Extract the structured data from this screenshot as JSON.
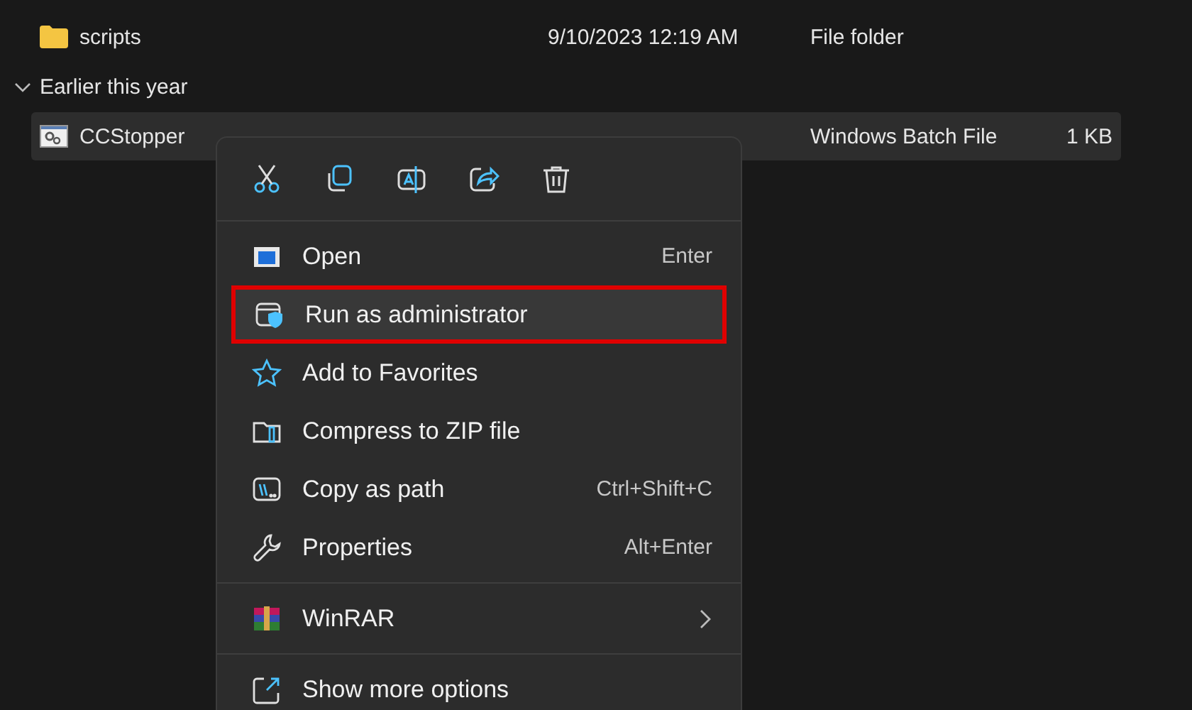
{
  "files": [
    {
      "name": "scripts",
      "date": "9/10/2023 12:19 AM",
      "type": "File folder",
      "kind": "folder",
      "selected": false
    }
  ],
  "groups": [
    {
      "label": "Earlier this year",
      "expanded": true,
      "files": [
        {
          "name": "CCStopper",
          "type": "Windows Batch File",
          "size": "1 KB",
          "kind": "batch",
          "selected": true
        }
      ]
    }
  ],
  "context_menu": {
    "sections": [
      [
        {
          "label": "Open",
          "shortcut": "Enter",
          "highlighted": false
        },
        {
          "label": "Run as administrator",
          "highlighted": true
        },
        {
          "label": "Add to Favorites",
          "highlighted": false
        },
        {
          "label": "Compress to ZIP file",
          "highlighted": false
        },
        {
          "label": "Copy as path",
          "shortcut": "Ctrl+Shift+C",
          "highlighted": false
        },
        {
          "label": "Properties",
          "shortcut": "Alt+Enter",
          "highlighted": false
        }
      ],
      [
        {
          "label": "WinRAR",
          "submenu": true,
          "highlighted": false
        }
      ],
      [
        {
          "label": "Show more options",
          "highlighted": false
        }
      ]
    ]
  }
}
